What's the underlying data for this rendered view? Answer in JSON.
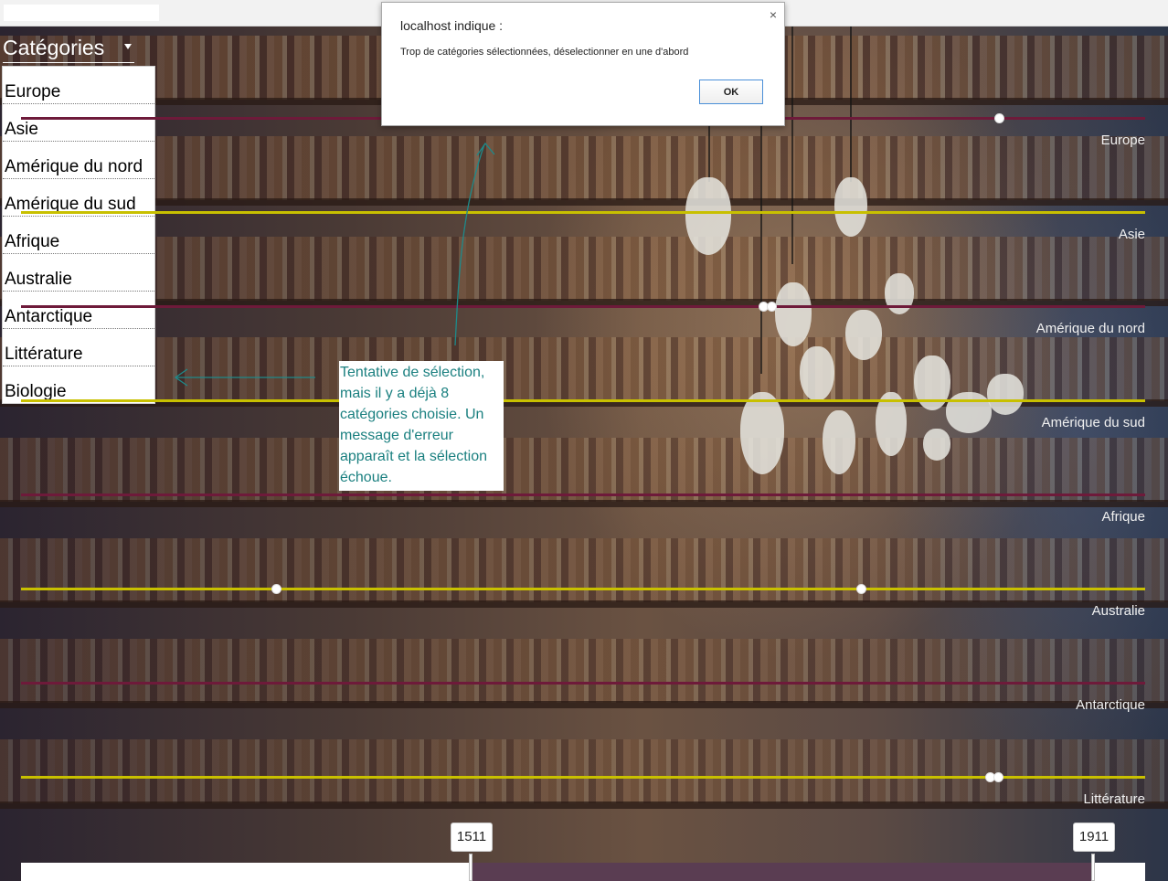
{
  "dropdown": {
    "label": "Catégories",
    "items": [
      "Europe",
      "Asie",
      "Amérique du nord",
      "Amérique du sud",
      "Afrique",
      "Australie",
      "Antarctique",
      "Littérature",
      "Biologie"
    ]
  },
  "tracks": [
    {
      "label": "Europe",
      "color": "#6e1a3a"
    },
    {
      "label": "Asie",
      "color": "#c8c000"
    },
    {
      "label": "Amérique du nord",
      "color": "#6e1a3a"
    },
    {
      "label": "Amérique du sud",
      "color": "#c8c000"
    },
    {
      "label": "Afrique",
      "color": "#6e1a3a"
    },
    {
      "label": "Australie",
      "color": "#c8c000"
    },
    {
      "label": "Antarctique",
      "color": "#6e1a3a"
    },
    {
      "label": "Littérature",
      "color": "#c8c000"
    }
  ],
  "dialog": {
    "title": "localhost indique :",
    "message": "Trop de catégories sélectionnées, déselectionner en une d'abord",
    "ok_label": "OK",
    "close_symbol": "×"
  },
  "annotation": {
    "text": "Tentative de sélection, mais il y a déjà 8 catégories choisie. Un message d'erreur apparaît et la sélection échoue."
  },
  "range": {
    "start_label": "1511",
    "end_label": "1911",
    "fill_color": "#5a3d52"
  }
}
